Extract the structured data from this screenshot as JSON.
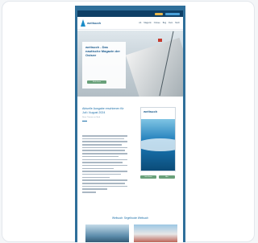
{
  "header": {
    "logo": "weitsuch",
    "nav": [
      "Ab",
      "Magazin",
      "Ostsee",
      "Bug",
      "Dein",
      "Mehr"
    ]
  },
  "hero": {
    "title": "weitsuch - Das nautische Magazin der Ostsee",
    "button": "Mehr lesen"
  },
  "lead": {
    "title": "Aktuelle Ausgabe erschienen für Juli / August 2024",
    "subtitle": "Neue Themen an Bord"
  },
  "cover": {
    "title": "weitsuch"
  },
  "cover_buttons": [
    "Jetzt lesen",
    "Abo"
  ],
  "section": {
    "title": "Weitsuch: Segelboote Weitsuch"
  }
}
